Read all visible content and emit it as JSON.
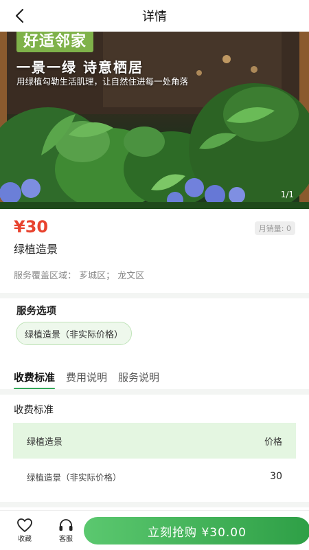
{
  "header": {
    "title": "详情"
  },
  "hero": {
    "brand": "好适邻家",
    "title": "一景一绿  诗意栖居",
    "subtitle": "用绿植勾勒生活肌理，让自然住进每一处角落",
    "pager": "1/1"
  },
  "product": {
    "price": "¥30",
    "sales": "月销量: 0",
    "name": "绿植造景",
    "coverage": "服务覆盖区域：  芗城区；  龙文区"
  },
  "options": {
    "title": "服务选项",
    "chip": "绿植造景（非实际价格）"
  },
  "tabs": [
    "收费标准",
    "费用说明",
    "服务说明"
  ],
  "fee": {
    "title": "收费标准",
    "header": {
      "name": "绿植造景",
      "price": "价格"
    },
    "rows": [
      {
        "name": "绿植造景（非实际价格）",
        "price": "30"
      }
    ]
  },
  "bottom": {
    "favorite": "收藏",
    "service": "客服",
    "buy": "立刻抢购 ¥30.00"
  },
  "colors": {
    "accent": "#35a85a",
    "price": "#e8432f",
    "chip_bg": "#eef8ec",
    "table_head": "#e4f6e1"
  }
}
